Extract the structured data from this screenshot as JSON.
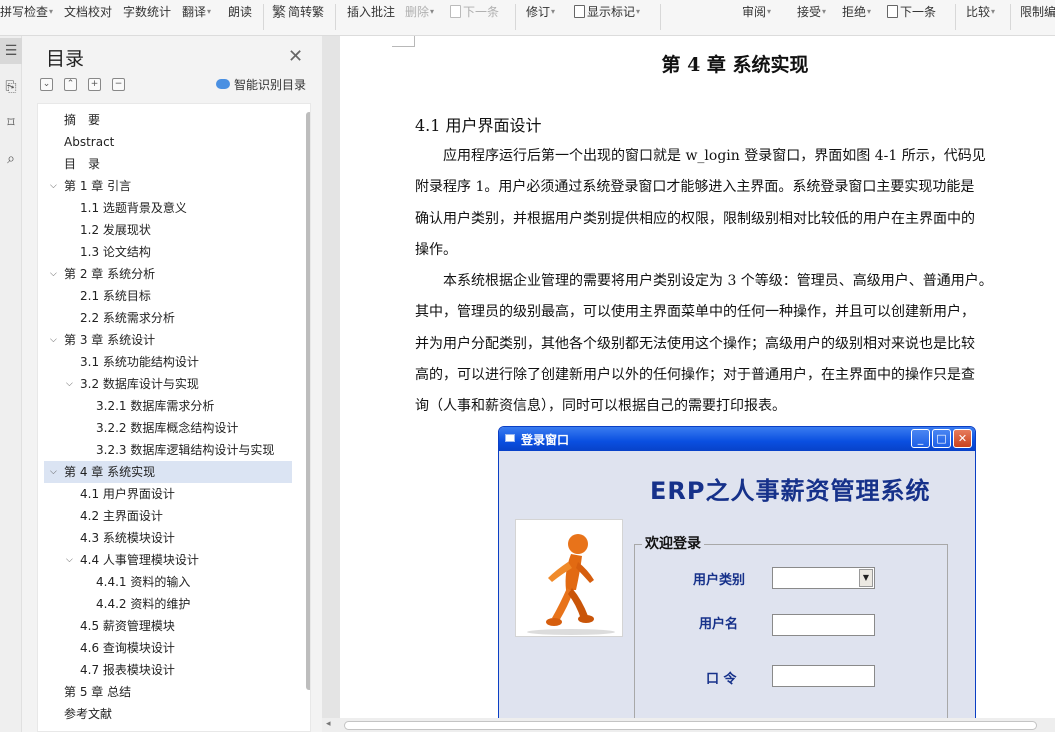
{
  "toolbar": {
    "items": [
      {
        "label": "拼写检查",
        "caret": true
      },
      {
        "label": "文档校对"
      },
      {
        "label": "字数统计"
      },
      {
        "label": "翻译",
        "caret": true
      },
      {
        "label": "朗读"
      },
      {
        "label": "简转繁"
      },
      {
        "label": "插入批注"
      },
      {
        "label": "删除",
        "caret": true,
        "disabled": true
      },
      {
        "label": "下一条",
        "disabled": true
      },
      {
        "label": "修订",
        "caret": true
      },
      {
        "label": "显示标记",
        "caret": true
      },
      {
        "label": "审阅",
        "caret": true
      },
      {
        "label": "接受",
        "caret": true
      },
      {
        "label": "拒绝",
        "caret": true
      },
      {
        "label": "下一条"
      },
      {
        "label": "比较",
        "caret": true
      },
      {
        "label": "限制编"
      }
    ],
    "icons": {
      "jian_fan": "繁"
    }
  },
  "toc": {
    "title": "目录",
    "smart_label": "智能识别目录",
    "items": [
      {
        "label": "摘　要",
        "level": 1
      },
      {
        "label": "Abstract",
        "level": 1
      },
      {
        "label": "目　录",
        "level": 1
      },
      {
        "label": "第 1 章  引言",
        "level": 1,
        "expanded": true
      },
      {
        "label": "1.1 选题背景及意义",
        "level": 2
      },
      {
        "label": "1.2 发展现状",
        "level": 2
      },
      {
        "label": "1.3 论文结构",
        "level": 2
      },
      {
        "label": "第 2 章  系统分析",
        "level": 1,
        "expanded": true
      },
      {
        "label": "2.1  系统目标",
        "level": 2
      },
      {
        "label": "2.2  系统需求分析",
        "level": 2
      },
      {
        "label": "第 3 章  系统设计",
        "level": 1,
        "expanded": true
      },
      {
        "label": "3.1  系统功能结构设计",
        "level": 2
      },
      {
        "label": "3.2  数据库设计与实现",
        "level": 2,
        "expanded": true
      },
      {
        "label": "3.2.1 数据库需求分析",
        "level": 3
      },
      {
        "label": "3.2.2 数据库概念结构设计",
        "level": 3
      },
      {
        "label": "3.2.3 数据库逻辑结构设计与实现",
        "level": 3
      },
      {
        "label": "第 4 章  系统实现",
        "level": 1,
        "expanded": true,
        "selected": true
      },
      {
        "label": "4.1  用户界面设计",
        "level": 2
      },
      {
        "label": "4.2  主界面设计",
        "level": 2
      },
      {
        "label": "4.3  系统模块设计",
        "level": 2
      },
      {
        "label": "4.4  人事管理模块设计",
        "level": 2,
        "expanded": true
      },
      {
        "label": "4.4.1  资料的输入",
        "level": 3
      },
      {
        "label": "4.4.2  资料的维护",
        "level": 3
      },
      {
        "label": "4.5  薪资管理模块",
        "level": 2
      },
      {
        "label": "4.6  查询模块设计",
        "level": 2
      },
      {
        "label": "4.7  报表模块设计",
        "level": 2
      },
      {
        "label": "第 5 章  总结",
        "level": 1
      },
      {
        "label": "参考文献",
        "level": 1
      }
    ]
  },
  "document": {
    "chapter_title": "第 4 章  系统实现",
    "section_title": "4.1  用户界面设计",
    "para1_lines": [
      "　　应用程序运行后第一个出现的窗口就是 w_login 登录窗口，界面如图 4-1 所示，代码见",
      "附录程序 1。用户必须通过系统登录窗口才能够进入主界面。系统登录窗口主要实现功能是",
      "确认用户类别，并根据用户类别提供相应的权限，限制级别相对比较低的用户在主界面中的",
      "操作。"
    ],
    "para2_lines": [
      "　　本系统根据企业管理的需要将用户类别设定为 3 个等级：管理员、高级用户、普通用户。",
      "其中，管理员的级别最高，可以使用主界面菜单中的任何一种操作，并且可以创建新用户，",
      "并为用户分配类别，其他各个级别都无法使用这个操作；高级用户的级别相对来说也是比较",
      "高的，可以进行除了创建新用户以外的任何操作；对于普通用户，在主界面中的操作只是查",
      "询（人事和薪资信息），同时可以根据自己的需要打印报表。"
    ]
  },
  "login_window": {
    "title": "登录窗口",
    "app_title": "ERP之人事薪资管理系统",
    "group_label": "欢迎登录",
    "user_type_label": "用户类别",
    "user_name_label": "用户名",
    "password_label": "口  令",
    "user_type_value": "",
    "user_name_value": "",
    "password_value": ""
  },
  "colors": {
    "accent": "#0a4fe0",
    "toc_selected": "#dbe4f3",
    "app_title": "#16318a"
  }
}
